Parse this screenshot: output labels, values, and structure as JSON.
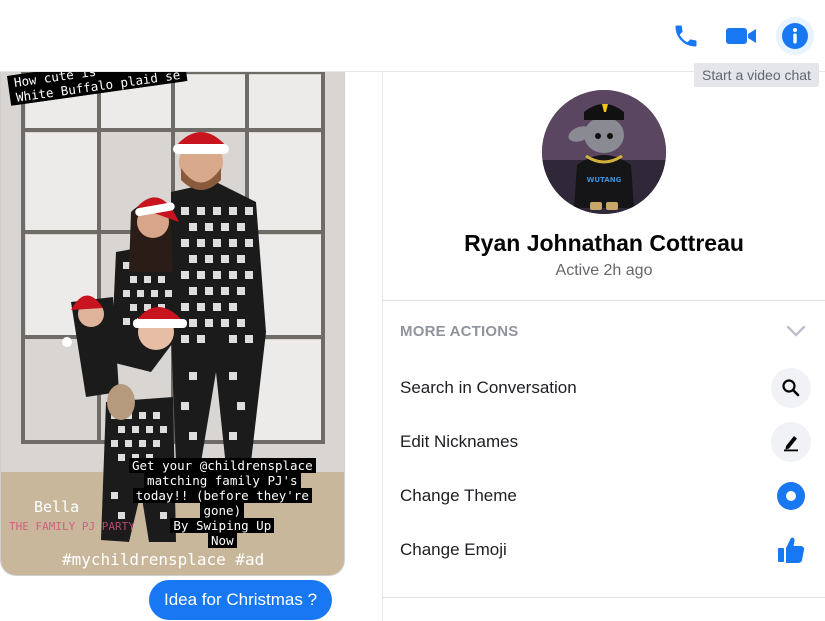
{
  "header": {
    "phone_icon": "phone-icon",
    "video_icon": "video-camera-icon",
    "info_icon": "info-icon",
    "tooltip": "Start a video chat",
    "accent": "#1877f2"
  },
  "conversation": {
    "story_image": {
      "overlay_top": [
        "How cute is",
        "White Buffalo plaid se"
      ],
      "overlay_middle": [
        "Get your @childrensplace",
        "matching family PJ's",
        "today!! (before they're",
        "gone)",
        "By Swiping Up",
        "Now"
      ],
      "overlay_name": "Bella",
      "overlay_party": "THE FAMILY PJ PARTY",
      "overlay_hashtags": "#mychildrensplace #ad"
    },
    "message": "Idea for Christmas ?",
    "bubble_color": "#1877f2"
  },
  "profile": {
    "name": "Ryan Johnathan Cottreau",
    "status": "Active 2h ago"
  },
  "actions": {
    "section_title": "MORE ACTIONS",
    "items": [
      {
        "label": "Search in Conversation",
        "icon": "search-icon"
      },
      {
        "label": "Edit Nicknames",
        "icon": "pencil-icon"
      },
      {
        "label": "Change Theme",
        "icon": "theme-circle-icon"
      },
      {
        "label": "Change Emoji",
        "icon": "thumbs-up-icon"
      }
    ]
  }
}
